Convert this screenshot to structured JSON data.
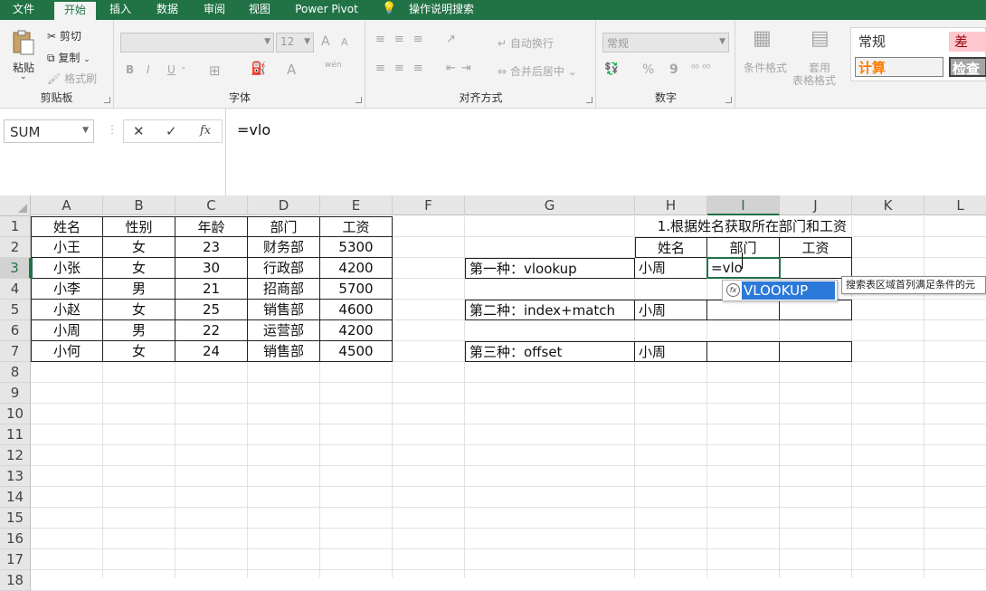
{
  "ribbon_tabs": [
    "文件",
    "开始",
    "插入",
    "数据",
    "审阅",
    "视图",
    "Power Pivot",
    "操作说明搜索"
  ],
  "active_tab": "开始",
  "clipboard": {
    "paste": "粘贴",
    "cut": "剪切",
    "copy": "复制",
    "format_painter": "格式刷",
    "label": "剪贴板"
  },
  "font": {
    "size": "12",
    "bold": "B",
    "italic": "I",
    "underline": "U",
    "grow": "A",
    "shrink": "A",
    "font_color": "A",
    "wen": "wén",
    "label": "字体"
  },
  "alignment": {
    "wrap": "自动换行",
    "merge": "合并后居中",
    "label": "对齐方式"
  },
  "number": {
    "format": "常规",
    "percent": "%",
    "comma": "9",
    "label": "数字"
  },
  "styles": {
    "conditional_format": "条件格式",
    "table_format_1": "套用",
    "table_format_2": "表格格式",
    "normal": "常规",
    "bad": "差",
    "calc": "计算",
    "check": "检查"
  },
  "formula_bar": {
    "name_box": "SUM",
    "cancel": "✕",
    "enter": "✓",
    "fx": "fx",
    "formula": "=vlo"
  },
  "columns": [
    "A",
    "B",
    "C",
    "D",
    "E",
    "F",
    "G",
    "H",
    "I",
    "J",
    "K",
    "L"
  ],
  "rows": [
    "1",
    "2",
    "3",
    "4",
    "5",
    "6",
    "7",
    "8",
    "9",
    "10",
    "11",
    "12",
    "13",
    "14",
    "15",
    "16",
    "17",
    "18"
  ],
  "selected_column": "I",
  "selected_row": "3",
  "table1": {
    "headers": [
      "姓名",
      "性别",
      "年龄",
      "部门",
      "工资"
    ],
    "rows": [
      [
        "小王",
        "女",
        "23",
        "财务部",
        "5300"
      ],
      [
        "小张",
        "女",
        "30",
        "行政部",
        "4200"
      ],
      [
        "小李",
        "男",
        "21",
        "招商部",
        "5700"
      ],
      [
        "小赵",
        "女",
        "25",
        "销售部",
        "4600"
      ],
      [
        "小周",
        "男",
        "22",
        "运营部",
        "4200"
      ],
      [
        "小何",
        "女",
        "24",
        "销售部",
        "4500"
      ]
    ]
  },
  "lookup": {
    "title": "1.根据姓名获取所在部门和工资",
    "headers": [
      "姓名",
      "部门",
      "工资"
    ],
    "method1": "第一种：vlookup",
    "method2": "第二种：index+match",
    "method3": "第三种：offset",
    "name1": "小周",
    "name2": "小周",
    "name3": "小周",
    "editing_value": "=vlo"
  },
  "autocomplete": {
    "item": "VLOOKUP",
    "tooltip": "搜索表区域首列满足条件的元"
  }
}
